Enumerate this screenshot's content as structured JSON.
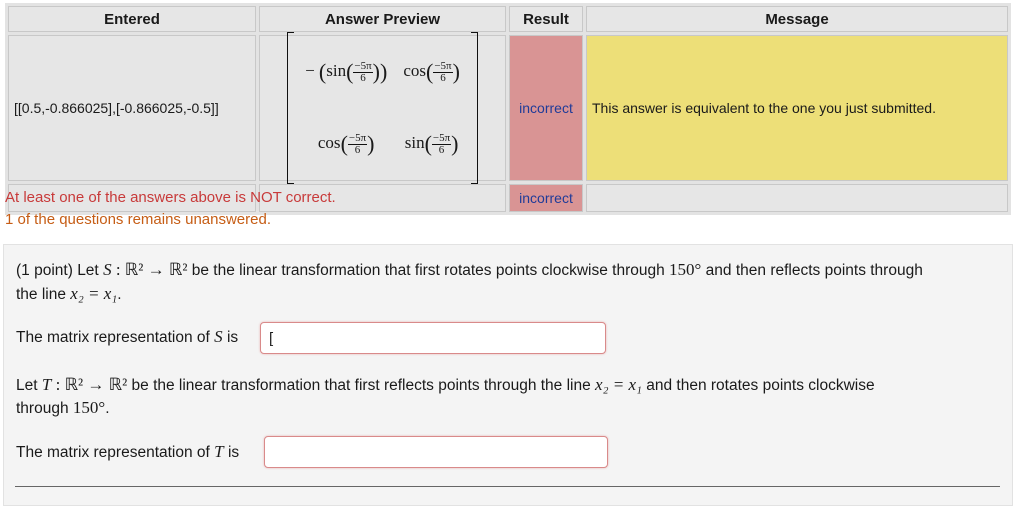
{
  "results_table": {
    "headers": [
      "Entered",
      "Answer Preview",
      "Result",
      "Message"
    ],
    "row1": {
      "entered": "[[0.5,-0.866025],[-0.866025,-0.5]]",
      "preview": {
        "minus": "−",
        "sin": "sin",
        "cos": "cos",
        "num": "−5π",
        "den": "6"
      },
      "result": "incorrect",
      "message": "This answer is equivalent to the one you just submitted."
    },
    "row2": {
      "entered": "",
      "preview": "",
      "result": "incorrect",
      "message": ""
    }
  },
  "warnings": {
    "line1": "At least one of the answers above is NOT correct.",
    "line2": "1 of the questions remains unanswered."
  },
  "problem": {
    "points": "(1 point)",
    "s_intro_a": "Let",
    "s_symbol": "S",
    "mapping": "ℝ² → ℝ²",
    "s_intro_b": "be the linear transformation that first rotates points clockwise through",
    "angle": "150°",
    "s_intro_c": "and then reflects points through",
    "s_intro_d": "the line",
    "line_eq": "x₂ = x₁",
    "period": ".",
    "s_matrix_label": "The matrix representation of",
    "is_word": "is",
    "s_input_value": "[",
    "t_intro_a": "Let",
    "t_symbol": "T",
    "t_intro_b": "be the linear transformation that first reflects points through the line",
    "t_intro_c": "and then rotates points clockwise",
    "t_intro_d": "through",
    "t_matrix_label": "The matrix representation of",
    "t_input_value": ""
  }
}
